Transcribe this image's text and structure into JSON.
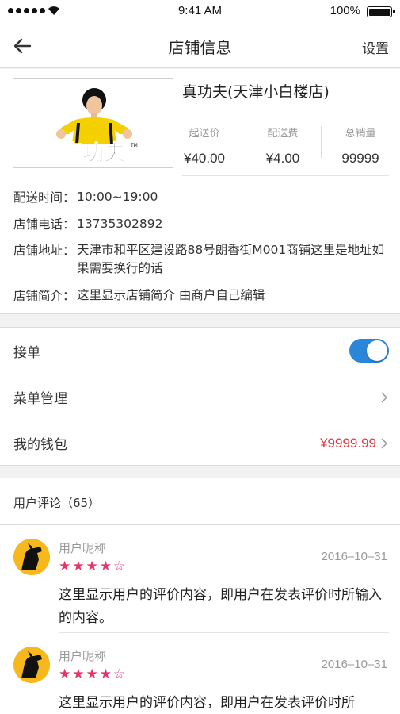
{
  "status_bar": {
    "time": "9:41 AM",
    "battery": "100%"
  },
  "nav": {
    "title": "店铺信息",
    "right_label": "设置"
  },
  "store": {
    "name": "真功夫(天津小白楼店)",
    "logo_text": "真功夫",
    "stats": [
      {
        "label": "起送价",
        "value": "¥40.00"
      },
      {
        "label": "配送费",
        "value": "¥4.00"
      },
      {
        "label": "总销量",
        "value": "99999"
      }
    ],
    "info": [
      {
        "key": "配送时间：",
        "value": "10:00~19:00"
      },
      {
        "key": "店铺电话：",
        "value": "13735302892"
      },
      {
        "key": "店铺地址：",
        "value": "天津市和平区建设路88号朗香街M001商铺这里是地址如果需要换行的话"
      },
      {
        "key": "店铺简介：",
        "value": "这里显示店铺简介 由商户自己编辑"
      }
    ]
  },
  "settings": {
    "accept_orders": {
      "label": "接单",
      "enabled": true
    },
    "menu": {
      "label": "菜单管理"
    },
    "wallet": {
      "label": "我的钱包",
      "amount": "¥9999.99"
    }
  },
  "reviews": {
    "header": "用户评论（65）",
    "items": [
      {
        "name": "用户昵称",
        "rating": 4,
        "max": 5,
        "date": "2016–10–31",
        "text": "这里显示用户的评价内容，即用户在发表评价时所输入的内容。"
      },
      {
        "name": "用户昵称",
        "rating": 4,
        "max": 5,
        "date": "2016–10–31",
        "text": "这里显示用户的评价内容，即用户在发表评价时所"
      }
    ]
  },
  "colors": {
    "accent": "#2a86d8",
    "price": "#e0383e",
    "star": "#e8336a",
    "avatar_bg": "#f6b81a"
  }
}
